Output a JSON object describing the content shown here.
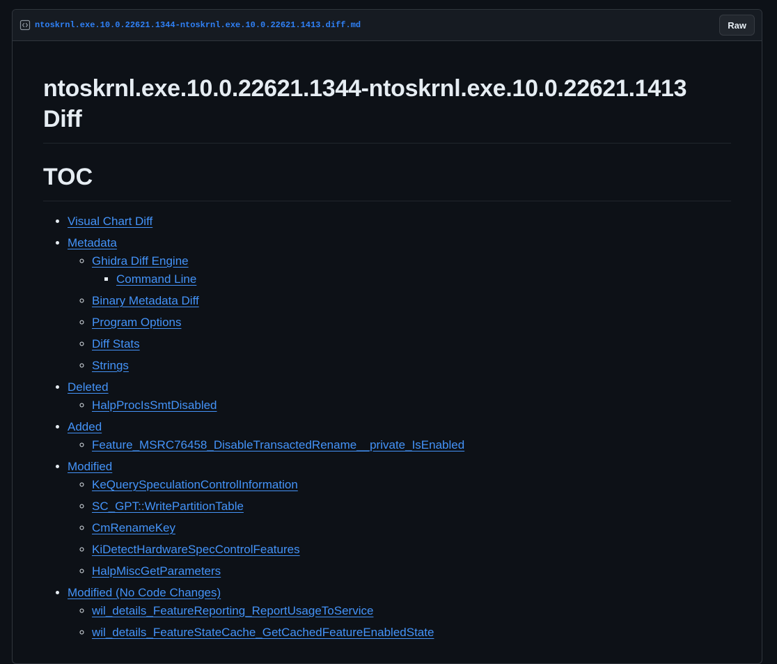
{
  "file": {
    "name": "ntoskrnl.exe.10.0.22621.1344-ntoskrnl.exe.10.0.22621.1413.diff.md",
    "raw_label": "Raw"
  },
  "doc": {
    "title": "ntoskrnl.exe.10.0.22621.1344-ntoskrnl.exe.10.0.22621.1413 Diff",
    "toc_heading": "TOC",
    "toc": {
      "visual_chart_diff": "Visual Chart Diff",
      "metadata": "Metadata",
      "ghidra_diff_engine": "Ghidra Diff Engine",
      "command_line": "Command Line",
      "binary_metadata_diff": "Binary Metadata Diff",
      "program_options": "Program Options",
      "diff_stats": "Diff Stats",
      "strings": "Strings",
      "deleted": "Deleted",
      "deleted_items": [
        "HalpProcIsSmtDisabled"
      ],
      "added": "Added",
      "added_items": [
        "Feature_MSRC76458_DisableTransactedRename__private_IsEnabled"
      ],
      "modified": "Modified",
      "modified_items": [
        "KeQuerySpeculationControlInformation",
        "SC_GPT::WritePartitionTable",
        "CmRenameKey",
        "KiDetectHardwareSpecControlFeatures",
        "HalpMiscGetParameters"
      ],
      "modified_no_code": "Modified (No Code Changes)",
      "modified_no_code_items": [
        "wil_details_FeatureReporting_ReportUsageToService",
        "wil_details_FeatureStateCache_GetCachedFeatureEnabledState"
      ]
    }
  },
  "colors": {
    "background": "#0d1117",
    "link": "#4493f8",
    "filename": "#2f81f7",
    "text": "#e6edf3",
    "border": "#30363d"
  },
  "icons": {
    "file_header": "code-square-icon"
  }
}
